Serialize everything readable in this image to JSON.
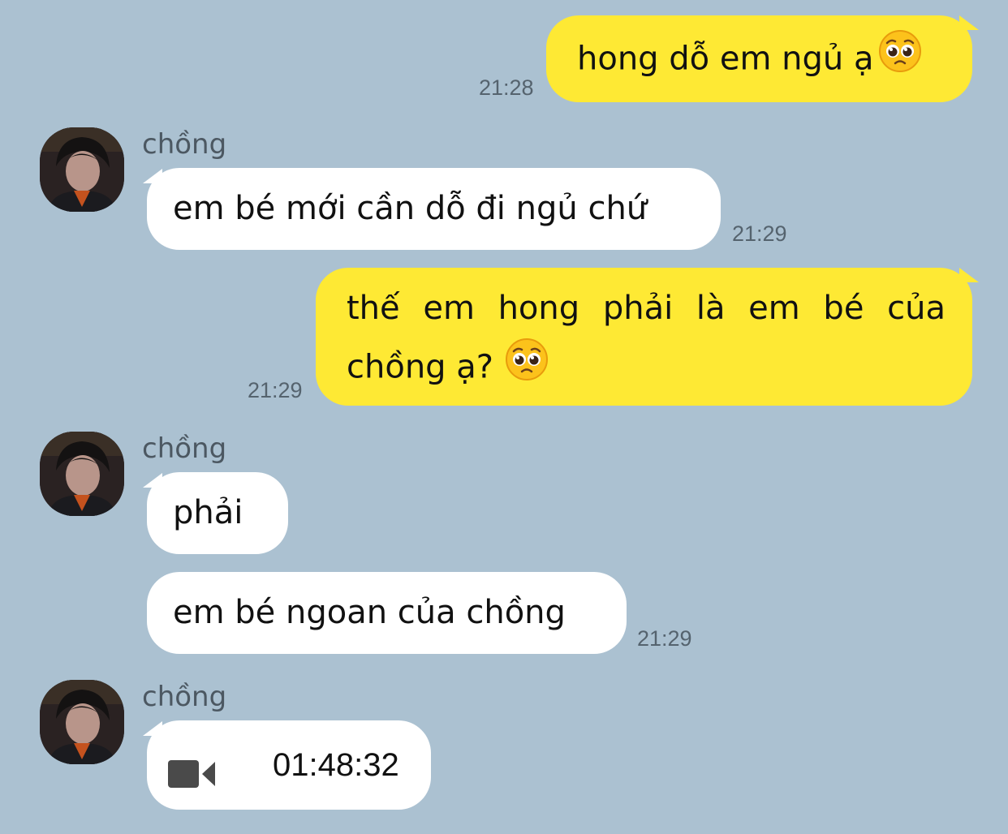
{
  "messages": [
    {
      "side": "me",
      "text": "hong dỗ em ngủ ạ",
      "emoji": "pleading-face",
      "time": "21:28"
    },
    {
      "side": "them",
      "sender": "chồng",
      "text": "em bé mới cần dỗ đi ngủ chứ",
      "time": "21:29"
    },
    {
      "side": "me",
      "line1_words": [
        "thế",
        "em",
        "hong",
        "phải",
        "là",
        "em",
        "bé",
        "của"
      ],
      "line2": "chồng ạ?",
      "emoji": "pleading-face",
      "time": "21:29"
    },
    {
      "side": "them",
      "sender": "chồng",
      "text": "phải"
    },
    {
      "side": "them",
      "text": "em bé ngoan của chồng",
      "time": "21:29"
    },
    {
      "side": "them",
      "sender": "chồng",
      "type": "video-call",
      "icon": "video-camera-icon",
      "duration": "01:48:32"
    }
  ],
  "colors": {
    "background": "#abc1d1",
    "my_bubble": "#fee934",
    "their_bubble": "#ffffff",
    "time_text": "#55636e"
  }
}
